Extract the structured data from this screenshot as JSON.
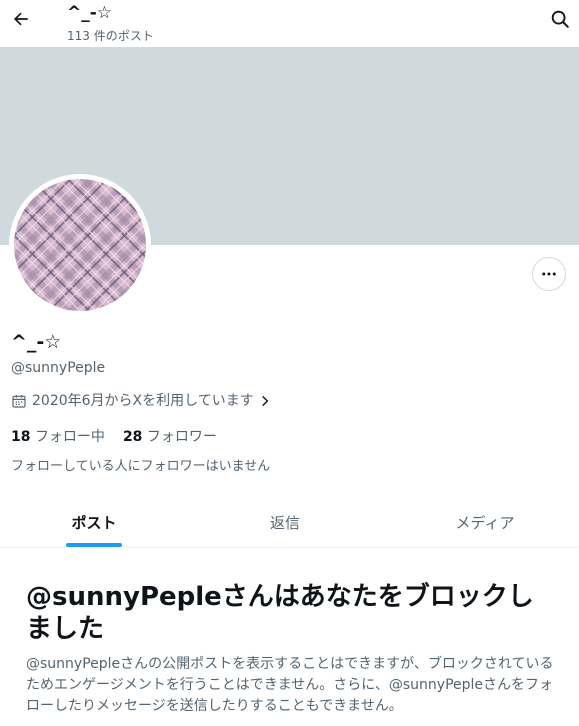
{
  "header": {
    "title": "^_-☆",
    "post_count": "113 件のポスト"
  },
  "profile": {
    "name": "^_-☆",
    "handle": "@sunnyPeple",
    "joined": "2020年6月からXを利用しています",
    "following_count": "18",
    "following_label": "フォロー中",
    "followers_count": "28",
    "followers_label": "フォロワー",
    "followers_you_know": "フォローしている人にフォロワーはいません"
  },
  "tabs": [
    {
      "label": "ポスト",
      "active": true
    },
    {
      "label": "返信",
      "active": false
    },
    {
      "label": "メディア",
      "active": false
    }
  ],
  "blocked": {
    "title": "@sunnyPepleさんはあなたをブロックしました",
    "body": "@sunnyPepleさんの公開ポストを表示することはできますが、ブロックされているためエンゲージメントを行うことはできません。さらに、@sunnyPepleさんをフォローしたりメッセージを送信したりすることもできません。"
  },
  "colors": {
    "banner": "#cfd9de",
    "accent": "#1d9bf0",
    "secondary_text": "#536471"
  },
  "icons": {
    "back": "arrow-left-icon",
    "search": "search-icon",
    "more": "more-horizontal-icon",
    "calendar": "calendar-icon",
    "chevron": "chevron-right-icon"
  }
}
